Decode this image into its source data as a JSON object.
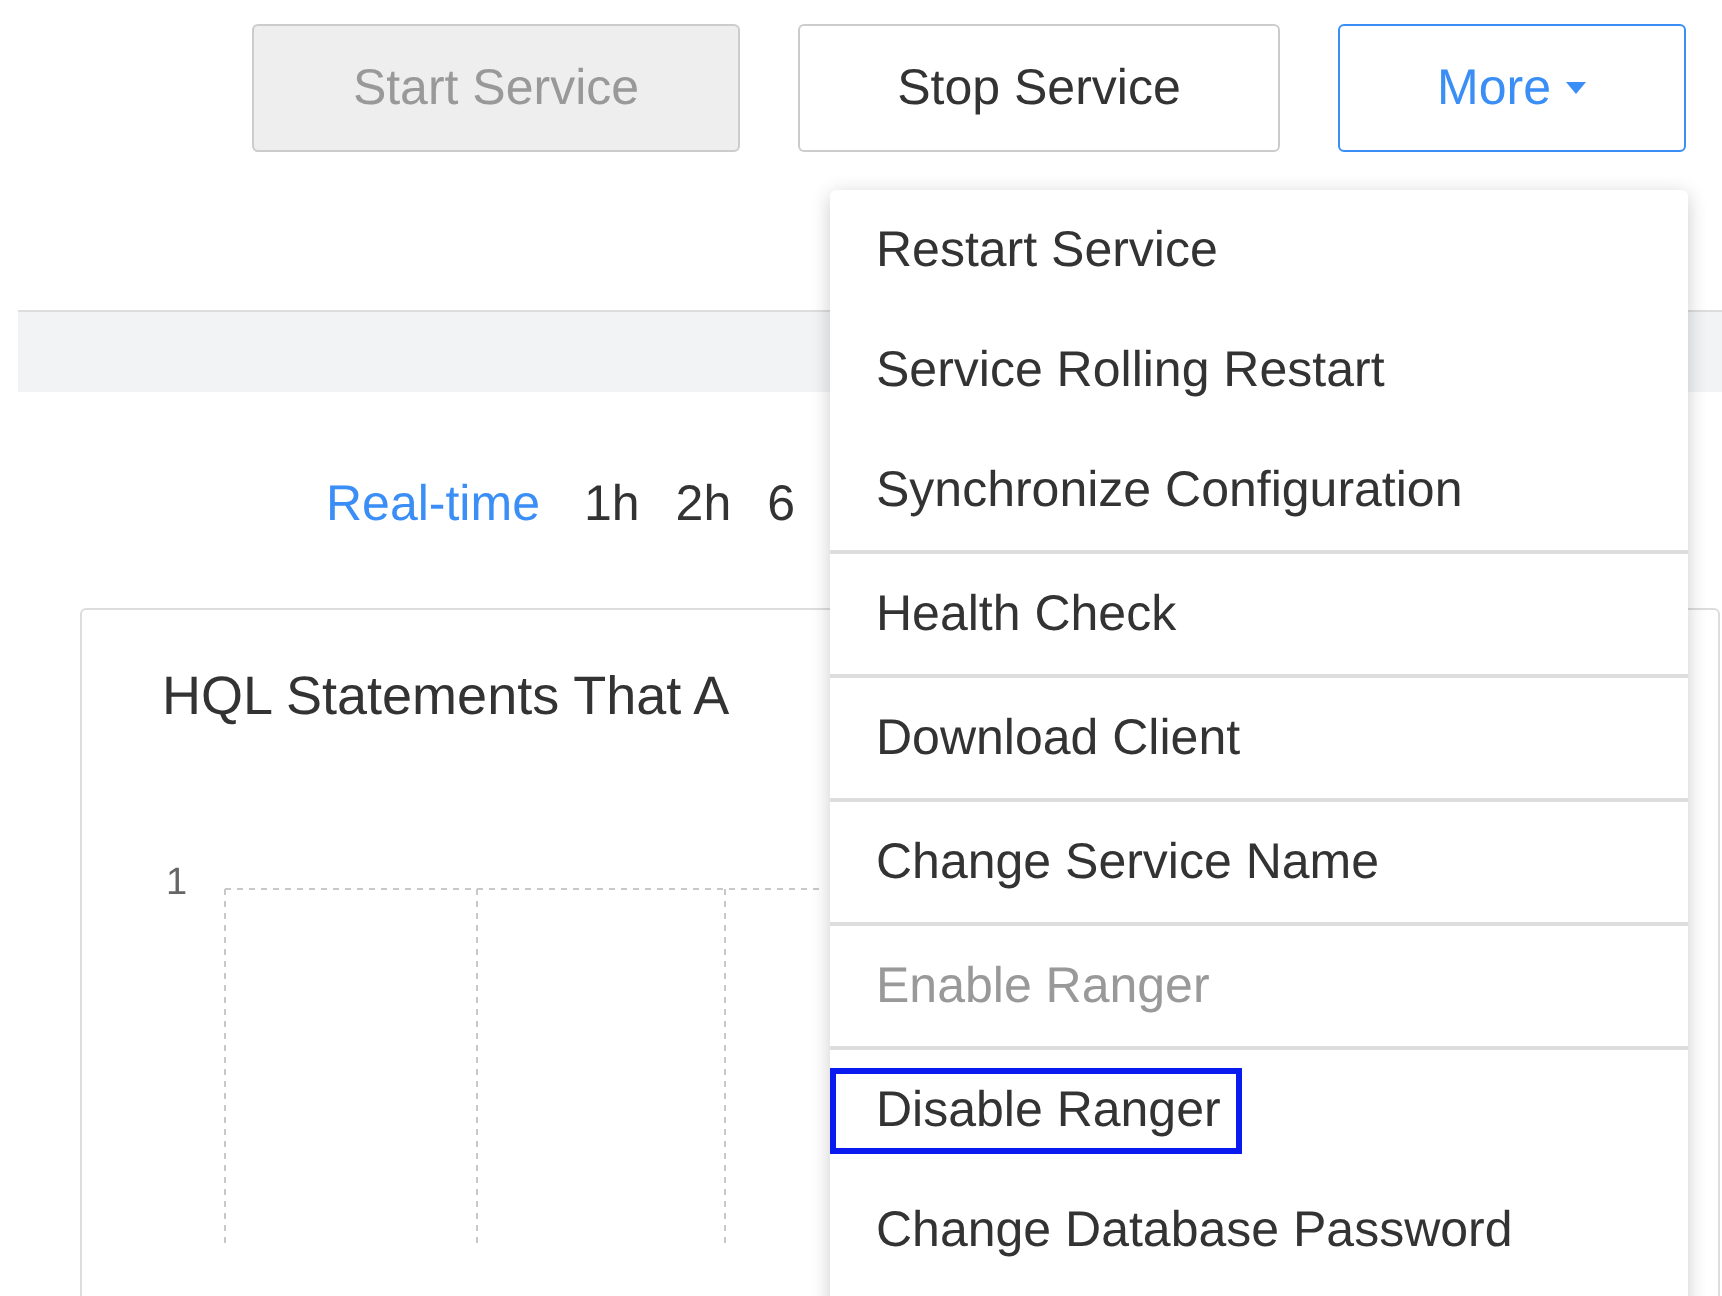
{
  "toolbar": {
    "buttons": [
      {
        "label": "Start Service",
        "disabled": true
      },
      {
        "label": "Stop Service",
        "disabled": false
      }
    ],
    "more": {
      "label": "More",
      "expanded": true
    }
  },
  "time_range": [
    {
      "label": "Real-time",
      "selected": true
    },
    {
      "label": "1h",
      "selected": false
    },
    {
      "label": "2h",
      "selected": false
    },
    {
      "label": "6",
      "selected": false
    }
  ],
  "chart_card": {
    "title": "HQL Statements That A",
    "y_tick": "1"
  },
  "more_menu": [
    {
      "label": "Restart Service",
      "divider_before": false,
      "disabled": false,
      "highlighted": false
    },
    {
      "label": "Service Rolling Restart",
      "divider_before": false,
      "disabled": false,
      "highlighted": false
    },
    {
      "label": "Synchronize Configuration",
      "divider_before": false,
      "disabled": false,
      "highlighted": false
    },
    {
      "label": "Health Check",
      "divider_before": true,
      "disabled": false,
      "highlighted": false
    },
    {
      "label": "Download Client",
      "divider_before": true,
      "disabled": false,
      "highlighted": false
    },
    {
      "label": "Change Service Name",
      "divider_before": true,
      "disabled": false,
      "highlighted": false
    },
    {
      "label": "Enable Ranger",
      "divider_before": true,
      "disabled": true,
      "highlighted": false
    },
    {
      "label": "Disable Ranger",
      "divider_before": true,
      "disabled": false,
      "highlighted": true
    },
    {
      "label": "Change Database Password",
      "divider_before": false,
      "disabled": false,
      "highlighted": false
    }
  ]
}
